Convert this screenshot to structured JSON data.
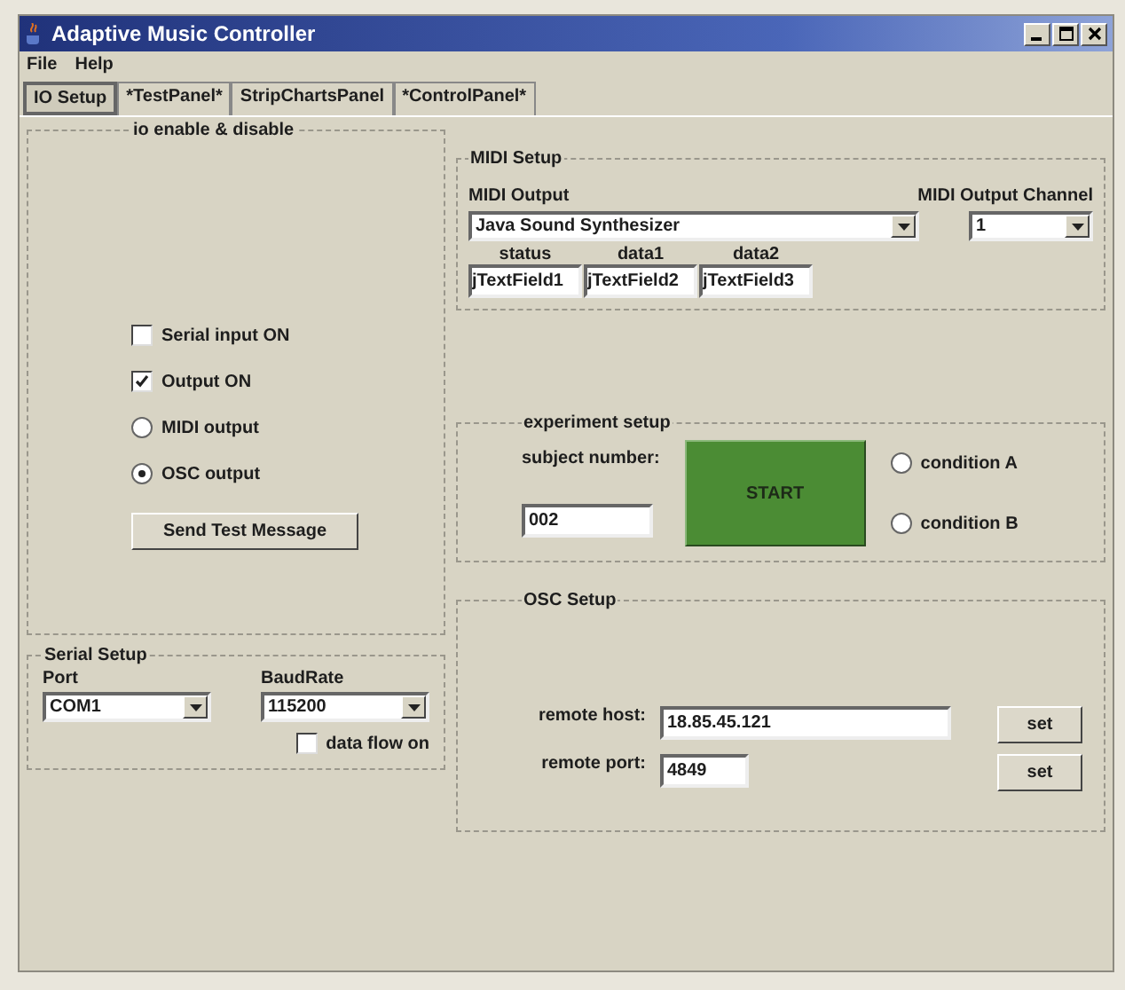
{
  "window": {
    "title": "Adaptive Music Controller"
  },
  "menu": [
    "File",
    "Help"
  ],
  "tabs": [
    {
      "label": "IO Setup",
      "selected": true
    },
    {
      "label": "*TestPanel*",
      "selected": false
    },
    {
      "label": "StripChartsPanel",
      "selected": false
    },
    {
      "label": "*ControlPanel*",
      "selected": false
    }
  ],
  "io_panel": {
    "title": "io enable & disable",
    "options": [
      {
        "kind": "checkbox",
        "label": "Serial input ON",
        "checked": false
      },
      {
        "kind": "checkbox",
        "label": "Output ON",
        "checked": true
      },
      {
        "kind": "radio",
        "label": "MIDI output",
        "selected": false
      },
      {
        "kind": "radio",
        "label": "OSC output",
        "selected": true
      }
    ],
    "button": "Send Test Message"
  },
  "serial_setup": {
    "title": "Serial Setup",
    "port_label": "Port",
    "port": "COM1",
    "baud_label": "BaudRate",
    "baud": "115200",
    "data_flow": {
      "label": "data flow on",
      "checked": false
    }
  },
  "midi_setup": {
    "title": "MIDI Setup",
    "output_label": "MIDI Output",
    "output": "Java Sound Synthesizer",
    "channel_label": "MIDI Output Channel",
    "channel": "1",
    "fields": [
      {
        "label": "status",
        "value": "jTextField1"
      },
      {
        "label": "data1",
        "value": "jTextField2"
      },
      {
        "label": "data2",
        "value": "jTextField3"
      }
    ]
  },
  "experiment_setup": {
    "title": "experiment setup",
    "subject_label": "subject number:",
    "subject": "002",
    "start_button": "START",
    "conditions": [
      {
        "label": "condition A",
        "selected": false
      },
      {
        "label": "condition B",
        "selected": false
      }
    ]
  },
  "osc_setup": {
    "title": "OSC Setup",
    "rows": [
      {
        "label": "remote host:",
        "value": "18.85.45.121",
        "button": "set"
      },
      {
        "label": "remote port:",
        "value": "4849",
        "button": "set"
      }
    ]
  }
}
